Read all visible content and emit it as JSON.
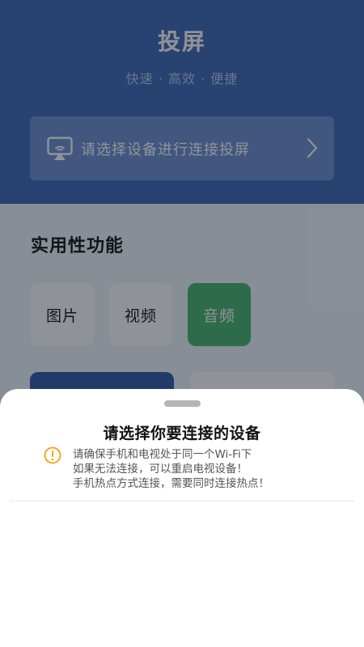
{
  "header": {
    "title": "投屏",
    "subtitle": "快速 · 高效 · 便捷",
    "connect_prompt": "请选择设备进行连接投屏"
  },
  "features": {
    "section_title": "实用性功能",
    "items": [
      {
        "label": "图片",
        "active": false
      },
      {
        "label": "视频",
        "active": false
      },
      {
        "label": "音频",
        "active": true
      }
    ]
  },
  "sheet": {
    "title": "请选择你要连接的设备",
    "notes": [
      "请确保手机和电视处于同一个Wi-Fi下",
      "如果无法连接，可以重启电视设备！",
      "手机热点方式连接，需要同时连接热点！"
    ]
  },
  "colors": {
    "primary": "#3a64b4",
    "accent_green": "#46b26c",
    "warning": "#f5a623"
  },
  "icons": {
    "cast": "screen-cast-icon",
    "chevron": "chevron-right-icon",
    "warning": "warning-icon"
  }
}
